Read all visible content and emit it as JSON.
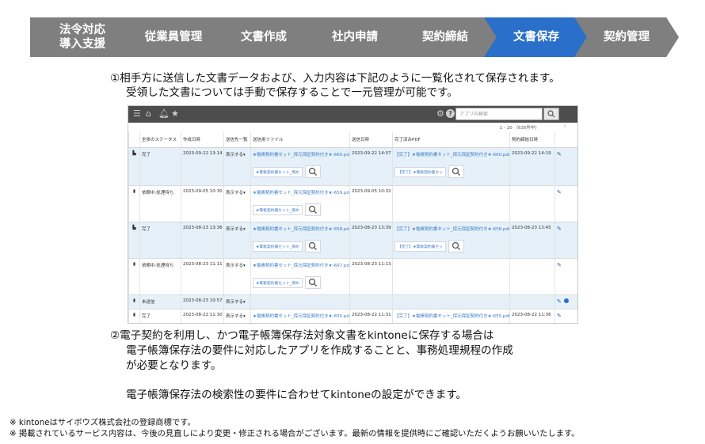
{
  "steps": [
    {
      "label": "法令対応\n導入支援",
      "active": false
    },
    {
      "label": "従業員管理",
      "active": false
    },
    {
      "label": "文書作成",
      "active": false
    },
    {
      "label": "社内申請",
      "active": false
    },
    {
      "label": "契約締結",
      "active": false
    },
    {
      "label": "文書保存",
      "active": true
    },
    {
      "label": "契約管理",
      "active": false
    }
  ],
  "caption1": {
    "line1": "①相手方に送信した文書データおよび、入力内容は下記のように一覧化されて保存されます。",
    "line2": "受領した文書については手動で保存することで一元管理が可能です。"
  },
  "app": {
    "search_placeholder": "アプリ内検索",
    "pager": "1 - 20 （635件中）",
    "columns": [
      "全体のステータス",
      "作成日時",
      "送信先一覧",
      "送信用ファイル",
      "送信日時",
      "完了済みPDF",
      "契約締結日時"
    ],
    "rows": [
      {
        "status": "完了",
        "created": "2023-09-22 13:14",
        "show": "表示する▾",
        "file": "★電帳契約書セット_保元保証契約付き★-660.pdf",
        "file_chip": "★電帳契約書セット_保め",
        "sent": "2023-09-22 14:07",
        "done_pdf": "【完了】★電帳契約書セット_保元保証契約付き★-660.pdf",
        "done_chip": "【完了】★電帳契約書セッ",
        "concluded": "2023-09-22 14:19",
        "highlight": true,
        "icon": "flag"
      },
      {
        "status": "依頼中:処理待ち",
        "created": "2023-09-05 10:30",
        "show": "表示する▾",
        "file": "★電帳契約書セット_保元保証契約付き★-659.pdf",
        "file_chip": "★電帳契約書セット_保め",
        "sent": "2023-09-05 10:32",
        "done_pdf": "",
        "done_chip": "",
        "concluded": "",
        "highlight": false,
        "icon": "doc"
      },
      {
        "status": "完了",
        "created": "2023-08-23 13:36",
        "show": "表示する▾",
        "file": "★電帳契約書セット_保元保証契約付き★-658.pdf",
        "file_chip": "★電帳契約書セット_保め",
        "sent": "2023-08-23 13:39",
        "done_pdf": "【完了】★電帳契約書セット_保元保証契約付き★-658.pdf",
        "done_chip": "【完了】★電帳契約書セッ",
        "concluded": "2023-08-23 13:45",
        "highlight": true,
        "icon": "flag"
      },
      {
        "status": "依頼中:処理待ち",
        "created": "2023-08-23 11:11",
        "show": "表示する▾",
        "file": "★電帳契約書セット_保元保証契約付き★-657.pdf",
        "file_chip": "★電帳契約書セット_保め",
        "sent": "2023-08-23 11:13",
        "done_pdf": "",
        "done_chip": "",
        "concluded": "",
        "highlight": false,
        "icon": "doc"
      },
      {
        "status": "未送信",
        "created": "2023-08-23 10:57",
        "show": "表示する▾",
        "file": "",
        "file_chip": "",
        "sent": "",
        "done_pdf": "",
        "done_chip": "",
        "concluded": "",
        "highlight": true,
        "icon": "doc"
      },
      {
        "status": "完了",
        "created": "2023-08-22 11:30",
        "show": "表示する▾",
        "file": "★電帳契約書セット_保元保証契約付き★-655.pdf",
        "file_chip": "",
        "sent": "2023-08-22 11:31",
        "done_pdf": "【完了】★電帳契約書セット_保元保証契約付き★-655.pdf",
        "done_chip": "",
        "concluded": "2023-08-22 11:36",
        "highlight": false,
        "icon": "doc"
      }
    ]
  },
  "caption2": {
    "line1": "②電子契約を利用し、かつ電子帳簿保存法対象文書をkintoneに保存する場合は",
    "line2": "電子帳簿保存法の要件に対応したアプリを作成することと、事務処理規程の作成",
    "line3": "が必要となります。",
    "line4": "電子帳簿保存法の検索性の要件に合わせてkintoneの設定ができます。"
  },
  "notes": [
    "※  kintoneはサイボウズ株式会社の登録商標です。",
    "※  掲載されているサービス内容は、今後の見直しにより変更・修正される場合がございます。最新の情報を提供時にご確認いただくようお願いいたします。"
  ],
  "colors": {
    "step": "#7f7f7f",
    "step_active": "#2a6fc9",
    "app_header": "#4d4d4d",
    "row_highlight": "#e5f0f8",
    "link": "#3a7bc8"
  }
}
